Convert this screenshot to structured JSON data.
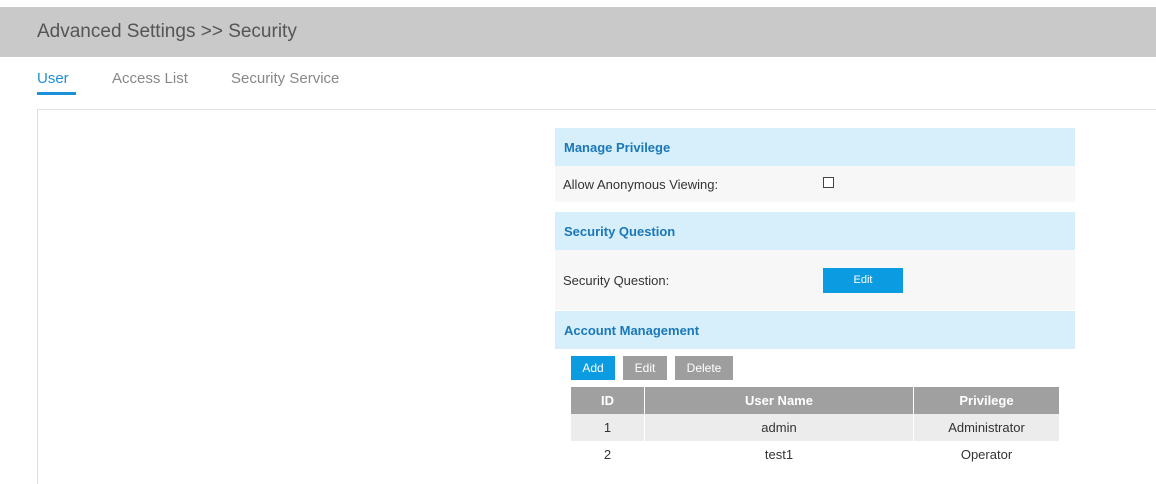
{
  "header": {
    "title": "Advanced Settings >> Security"
  },
  "tabs": [
    {
      "label": "User",
      "active": true
    },
    {
      "label": "Access List",
      "active": false
    },
    {
      "label": "Security Service",
      "active": false
    }
  ],
  "manage_privilege": {
    "title": "Manage Privilege",
    "anonymous_label": "Allow Anonymous Viewing:",
    "anonymous_checked": false
  },
  "security_question": {
    "title": "Security Question",
    "label": "Security Question:",
    "edit_label": "Edit"
  },
  "account_management": {
    "title": "Account Management",
    "add_label": "Add",
    "edit_label": "Edit",
    "delete_label": "Delete",
    "columns": [
      "ID",
      "User Name",
      "Privilege"
    ],
    "rows": [
      {
        "id": "1",
        "user_name": "admin",
        "privilege": "Administrator"
      },
      {
        "id": "2",
        "user_name": "test1",
        "privilege": "Operator"
      }
    ]
  },
  "colors": {
    "accent": "#0b9be0",
    "section_header_bg": "#d6effb",
    "section_header_text": "#1a77b8",
    "header_bg": "#c9c9c9",
    "gray_button": "#9e9e9e"
  }
}
